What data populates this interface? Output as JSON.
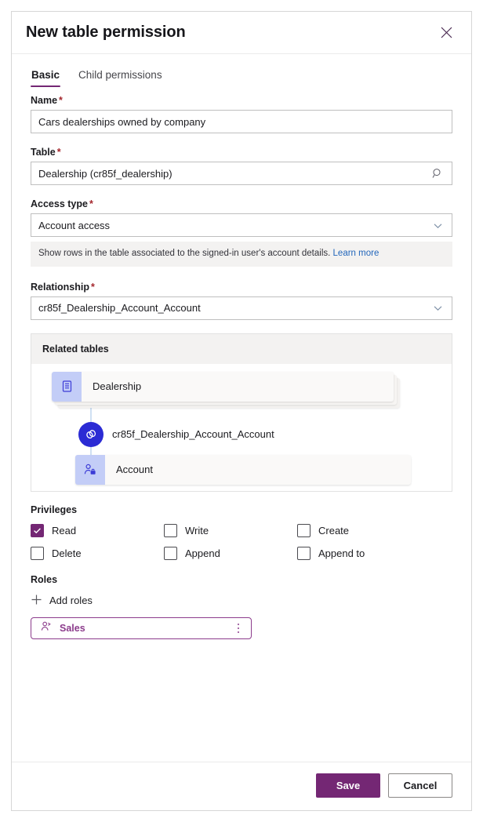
{
  "dialog": {
    "title": "New table permission",
    "close_icon": "close-icon"
  },
  "tabs": [
    {
      "label": "Basic",
      "active": true
    },
    {
      "label": "Child permissions",
      "active": false
    }
  ],
  "form": {
    "name": {
      "label": "Name",
      "required": "*",
      "value": "Cars dealerships owned by company"
    },
    "table": {
      "label": "Table",
      "required": "*",
      "value": "Dealership (cr85f_dealership)",
      "icon": "search-icon"
    },
    "access_type": {
      "label": "Access type",
      "required": "*",
      "value": "Account access",
      "icon": "chevron-down-icon",
      "hint_text": "Show rows in the table associated to the signed-in user's account details.",
      "hint_link": "Learn more"
    },
    "relationship": {
      "label": "Relationship",
      "required": "*",
      "value": "cr85f_Dealership_Account_Account",
      "icon": "chevron-down-icon"
    }
  },
  "related_tables": {
    "header": "Related tables",
    "source_node": {
      "label": "Dealership",
      "icon": "table-document-icon"
    },
    "relationship_node": {
      "label": "cr85f_Dealership_Account_Account",
      "icon": "link-rings-icon"
    },
    "target_node": {
      "label": "Account",
      "icon": "account-person-icon"
    }
  },
  "privileges": {
    "label": "Privileges",
    "items": [
      {
        "label": "Read",
        "checked": true
      },
      {
        "label": "Write",
        "checked": false
      },
      {
        "label": "Create",
        "checked": false
      },
      {
        "label": "Delete",
        "checked": false
      },
      {
        "label": "Append",
        "checked": false
      },
      {
        "label": "Append to",
        "checked": false
      }
    ]
  },
  "roles": {
    "label": "Roles",
    "add_label": "Add roles",
    "add_icon": "plus-icon",
    "chips": [
      {
        "label": "Sales",
        "icon": "person-role-icon",
        "more_icon": "more-vertical-icon"
      }
    ]
  },
  "footer": {
    "save_label": "Save",
    "cancel_label": "Cancel"
  },
  "colors": {
    "accent_purple": "#742774",
    "role_purple": "#8c3c8c",
    "required_red": "#a4262c",
    "link_blue": "#2266bb",
    "node_icon_bg": "#c3cdf7",
    "relationship_circle": "#2b2bd4",
    "connector_line": "#cfe0f3"
  }
}
